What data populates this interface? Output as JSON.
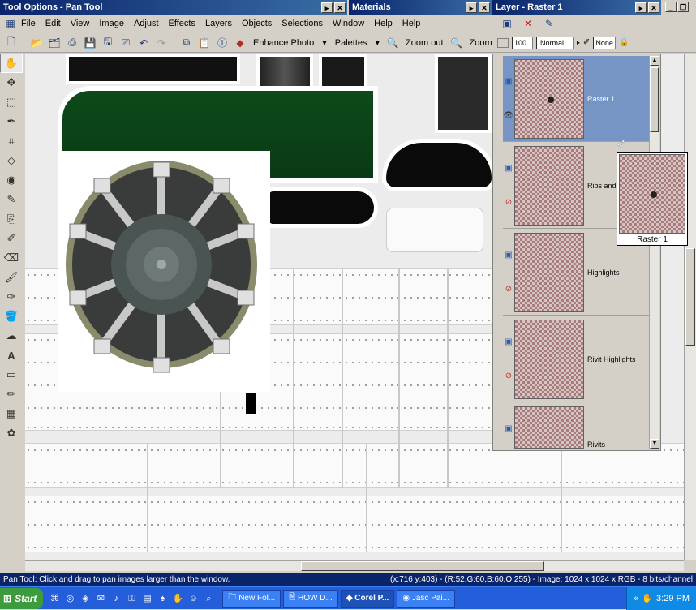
{
  "windows": {
    "tool_options_title": "Tool Options - Pan Tool",
    "materials_title": "Materials",
    "layer_title": "Layer - Raster 1"
  },
  "menu": [
    "File",
    "Edit",
    "View",
    "Image",
    "Adjust",
    "Effects",
    "Layers",
    "Objects",
    "Selections",
    "Window",
    "Help",
    "Help"
  ],
  "toolbar": {
    "enhance_photo": "Enhance Photo",
    "palettes": "Palettes",
    "zoom_out": "Zoom out",
    "zoom_in": "Zoom in",
    "opacity": "100",
    "blend_mode": "Normal",
    "mask_mode": "None"
  },
  "layers": [
    {
      "name": "Raster 1",
      "selected": true
    },
    {
      "name": "Ribs and b",
      "selected": false
    },
    {
      "name": "Highlights",
      "selected": false
    },
    {
      "name": "Rivit Highlights",
      "selected": false
    },
    {
      "name": "Rivits",
      "selected": false
    }
  ],
  "preview_label": "Raster 1",
  "status": {
    "left": "Pan Tool: Click and drag to pan images larger than the window.",
    "right": "(x:716 y:403) - (R:52,G:60,B:60,O:255) - Image:  1024 x 1024 x RGB - 8 bits/channel"
  },
  "taskbar": {
    "start": "Start",
    "tasks": [
      "New Fol...",
      "HOW D...",
      "Corel P...",
      "Jasc Pai..."
    ],
    "active_task": 2,
    "time": "3:29 PM"
  },
  "colors": {
    "title_active": "#0a246a",
    "layer_selected": "#7795c4",
    "taskbar": "#245edb",
    "start_green": "#3c9b3c"
  }
}
